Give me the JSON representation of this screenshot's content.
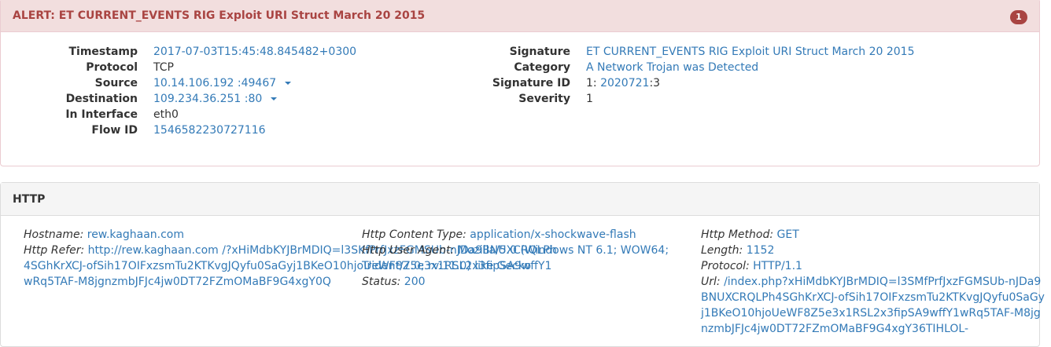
{
  "alert": {
    "title": "ALERT: ET CURRENT_EVENTS RIG Exploit URI Struct March 20 2015",
    "count": "1",
    "left": {
      "timestamp_label": "Timestamp",
      "timestamp": "2017-07-03T15:45:48.845482+0300",
      "protocol_label": "Protocol",
      "protocol": "TCP",
      "source_label": "Source",
      "source_ip": "10.14.106.192",
      "source_port": ":49467",
      "destination_label": "Destination",
      "destination_ip": "109.234.36.251",
      "destination_port": ":80",
      "interface_label": "In Interface",
      "interface": "eth0",
      "flow_label": "Flow ID",
      "flow": "1546582230727116"
    },
    "right": {
      "signature_label": "Signature",
      "signature": "ET CURRENT_EVENTS RIG Exploit URI Struct March 20 2015",
      "category_label": "Category",
      "category": "A Network Trojan was Detected",
      "sigid_label": "Signature ID",
      "sigid_prefix": "1:",
      "sigid": "2020721",
      "sigid_suffix": ":3",
      "severity_label": "Severity",
      "severity": "1"
    }
  },
  "http": {
    "title": "HTTP",
    "hostname_label": "Hostname:",
    "hostname": "rew.kaghaan.com",
    "refer_label": "Http Refer:",
    "refer": "http://rew.kaghaan.com /?xHiMdbKYJBrMDIQ=l3SKfPrfJxzFGMSUb-nJDa9BNUXCRQLPh4SGhKrXCJ-ofSih17OIFxzsmTu2KTKvgJQyfu0SaGyj1BKeO10hjoUeWF8Z5e3x1RSL2x3fipSA9wffY1wRq5TAF-M8jgnzmbJFJc4jw0DT72FZmOMaBF9G4xgY0Q",
    "content_type_label": "Http Content Type:",
    "content_type": "application/x-shockwave-flash",
    "user_agent_label": "Http User Agent:",
    "user_agent": "Mozilla/5.0 (Windows NT 6.1; WOW64; Trident/7.0; rv:11.0) like Gecko",
    "status_label": "Status:",
    "status": "200",
    "method_label": "Http Method:",
    "method": "GET",
    "length_label": "Length:",
    "length": "1152",
    "protocol_label": "Protocol:",
    "protocol": "HTTP/1.1",
    "url_label": "Url:",
    "url": "/index.php?xHiMdbKYJBrMDIQ=l3SMfPrfJxzFGMSUb-nJDa9BNUXCRQLPh4SGhKrXCJ-ofSih17OIFxzsmTu2KTKvgJQyfu0SaGyj1BKeO10hjoUeWF8Z5e3x1RSL2x3fipSA9wffY1wRq5TAF-M8jgnzmbJFJc4jw0DT72FZmOMaBF9G4xgY36TIHLOL-"
  }
}
